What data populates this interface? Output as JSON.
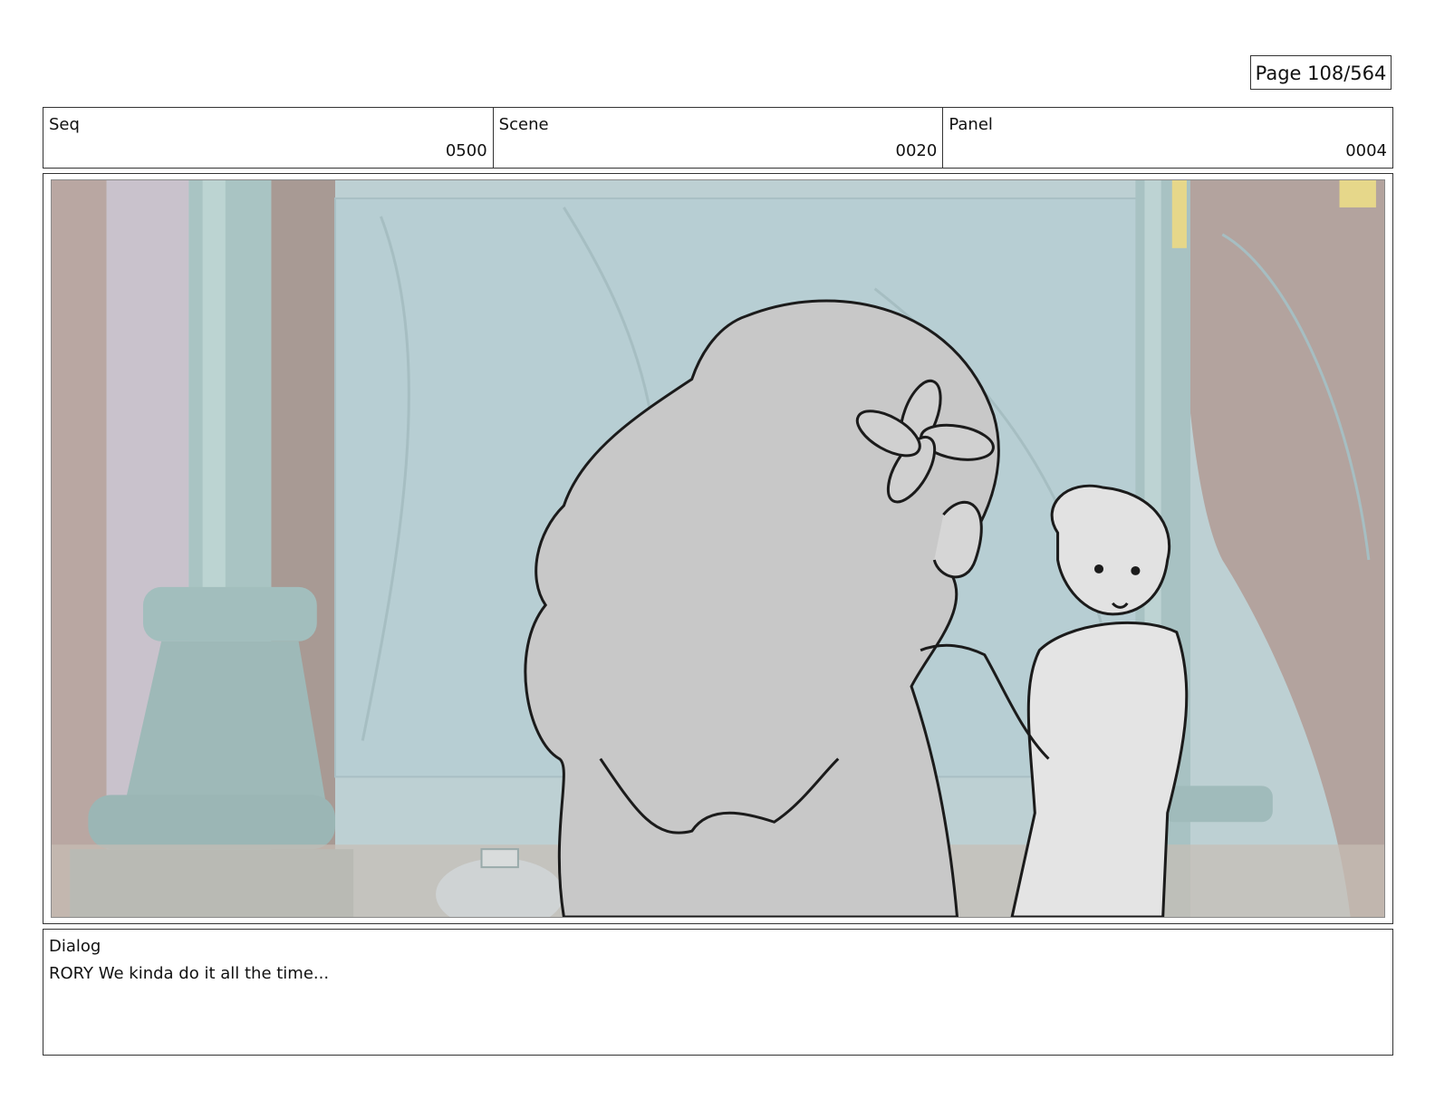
{
  "page": {
    "label": "Page 108/564"
  },
  "header": {
    "seq": {
      "label": "Seq",
      "value": "0500"
    },
    "scene": {
      "label": "Scene",
      "value": "0020"
    },
    "panel": {
      "label": "Panel",
      "value": "0004"
    }
  },
  "frame": {
    "image": "storyboard-panel-drawing"
  },
  "dialog": {
    "label": "Dialog",
    "text": "RORY We kinda do it all the time..."
  }
}
